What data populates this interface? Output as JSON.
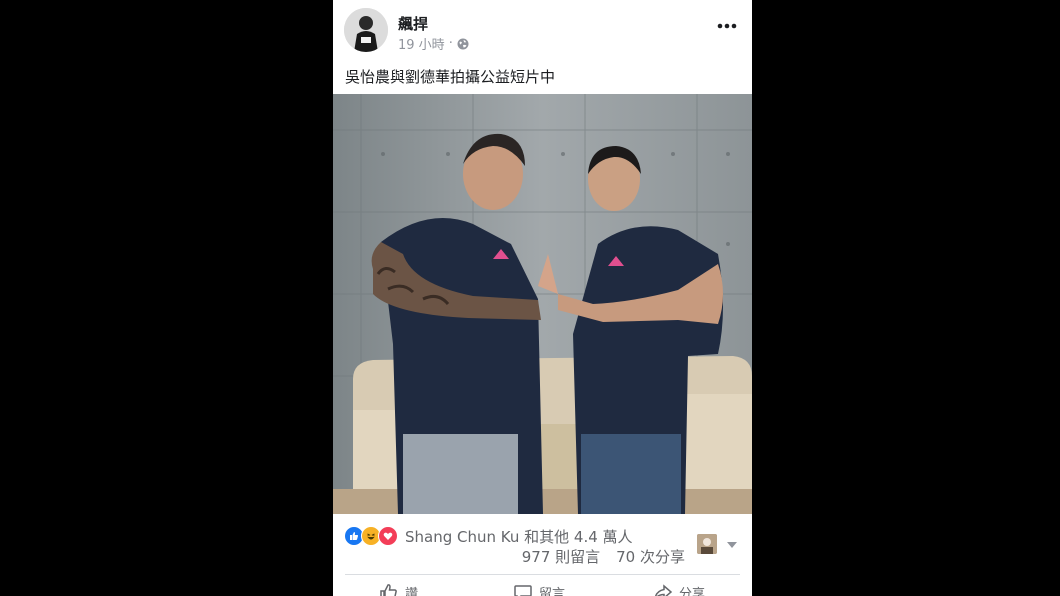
{
  "post": {
    "author": "飆捍",
    "time": "19 小時",
    "separator": "·",
    "privacy_icon": "globe-icon",
    "more_icon": "more-horizontal-icon",
    "caption": "吳怡農與劉德華拍攝公益短片中"
  },
  "reactions": {
    "icons": [
      "like-icon",
      "haha-icon",
      "love-icon"
    ],
    "summary": "Shang Chun Ku 和其他 4.4 萬人",
    "comments": "977 則留言",
    "shares": "70 次分享"
  },
  "actions": {
    "like": "讚",
    "comment": "留言",
    "share": "分享"
  },
  "colors": {
    "background": "#000000",
    "card": "#ffffff",
    "like_blue": "#1877f2",
    "love_red": "#f33e58",
    "haha_yellow": "#f7b125",
    "muted_text": "#65676b"
  }
}
